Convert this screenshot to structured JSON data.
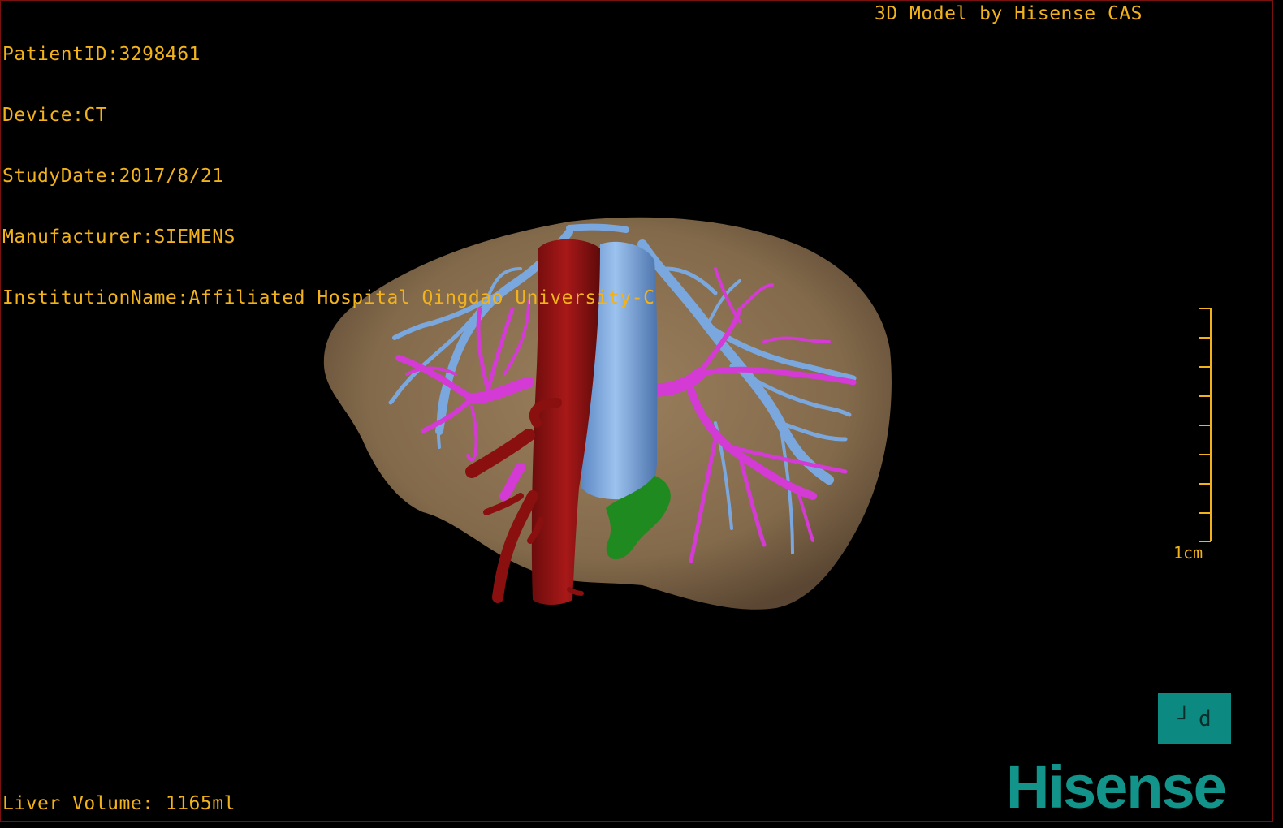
{
  "header": {
    "patient_id": "PatientID:3298461",
    "device": "Device:CT",
    "study_date": "StudyDate:2017/8/21",
    "manufacturer": "Manufacturer:SIEMENS",
    "institution": "InstitutionName:Affiliated Hospital Qingdao University-C",
    "title": "3D Model by Hisense CAS"
  },
  "footer": {
    "liver_volume": "Liver Volume: 1165ml"
  },
  "scale": {
    "label": "1cm"
  },
  "orientation": {
    "glyph_left": "┘",
    "glyph_right": "d"
  },
  "brand": {
    "logo_text": "Hisense"
  },
  "colors": {
    "text": "#f2b21b",
    "liver": "#8a7150",
    "hepatic_vein": "#7aa8de",
    "portal_vein": "#d43ad4",
    "artery": "#9a1414",
    "gallbladder": "#1f8a1f",
    "brand": "#12948a"
  },
  "icons": [
    "orientation-cube-icon",
    "scale-ruler-icon"
  ]
}
